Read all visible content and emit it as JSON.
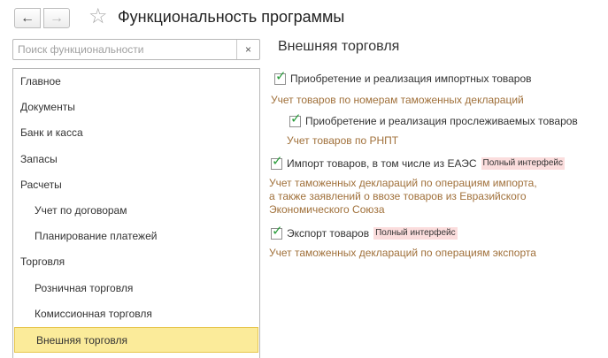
{
  "window": {
    "title": "Функциональность программы"
  },
  "search": {
    "placeholder": "Поиск функциональности",
    "clear_label": "×"
  },
  "sidebar": {
    "items": [
      {
        "label": "Главное"
      },
      {
        "label": "Документы"
      },
      {
        "label": "Банк и касса"
      },
      {
        "label": "Запасы"
      },
      {
        "label": "Расчеты"
      },
      {
        "label": "Учет по договорам"
      },
      {
        "label": "Планирование платежей"
      },
      {
        "label": "Торговля"
      },
      {
        "label": "Розничная торговля"
      },
      {
        "label": "Комиссионная торговля"
      },
      {
        "label": "Внешняя торговля"
      }
    ]
  },
  "main": {
    "title": "Внешняя торговля",
    "options": [
      {
        "label": "Приобретение и реализация импортных товаров",
        "checked": true,
        "description": "Учет товаров по номерам таможенных деклараций"
      },
      {
        "label": "Приобретение и реализация прослеживаемых товаров",
        "checked": true,
        "description": "Учет товаров по РНПТ"
      },
      {
        "label": "Импорт товаров, в том числе из ЕАЭС",
        "checked": true,
        "badge": "Полный интерфейс",
        "description": "Учет таможенных деклараций по операциям импорта,\nа также заявлений о ввозе товаров из Евразийского\nЭкономического Союза"
      },
      {
        "label": "Экспорт товаров",
        "checked": true,
        "badge": "Полный интерфейс",
        "description": "Учет таможенных деклараций по операциям экспорта"
      }
    ]
  },
  "colors": {
    "selected_bg": "#fbeb9a",
    "check": "#2a9d3c",
    "description": "#a0703a",
    "badge_bg": "#fbdddd"
  }
}
